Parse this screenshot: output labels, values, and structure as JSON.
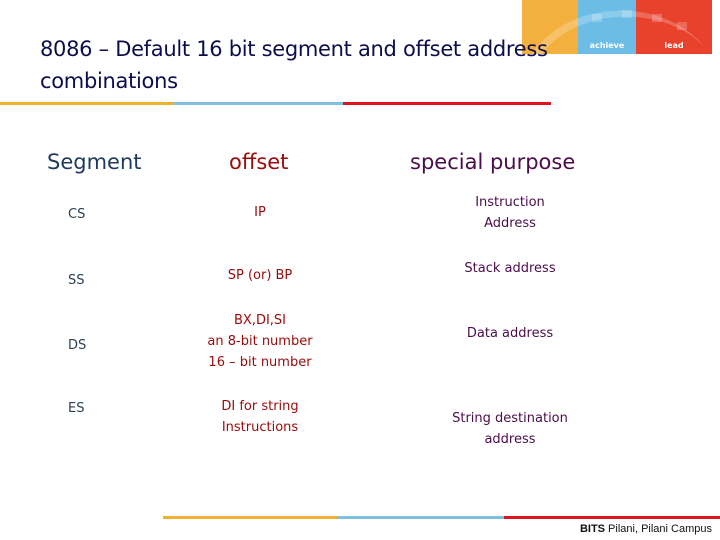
{
  "banner": {
    "labels": [
      "",
      "achieve",
      "lead"
    ],
    "colors": [
      "#f4b03e",
      "#6cbde6",
      "#e8412c"
    ]
  },
  "slide": {
    "title": "8086 – Default 16 bit segment and offset address combinations"
  },
  "table": {
    "headers": {
      "segment": "Segment",
      "offset": "offset",
      "special": "special purpose"
    },
    "rows": [
      {
        "segment": "CS",
        "offset": "IP",
        "special": "Instruction\nAddress"
      },
      {
        "segment": "SS",
        "offset": "SP (or) BP",
        "special": "Stack address"
      },
      {
        "segment": "DS",
        "offset": "BX,DI,SI\nan 8-bit number\n16 – bit number",
        "special": "Data address"
      },
      {
        "segment": "ES",
        "offset": "DI for string\nInstructions",
        "special": "String destination\naddress"
      }
    ]
  },
  "footer": {
    "brand": "BITS",
    "campus": " Pilani, Pilani Campus"
  },
  "colors": {
    "title": "#0d0d4d",
    "segment_column": "#1f3a5c",
    "offset_column": "#9a0b0b",
    "special_column": "#4a0d4a"
  }
}
